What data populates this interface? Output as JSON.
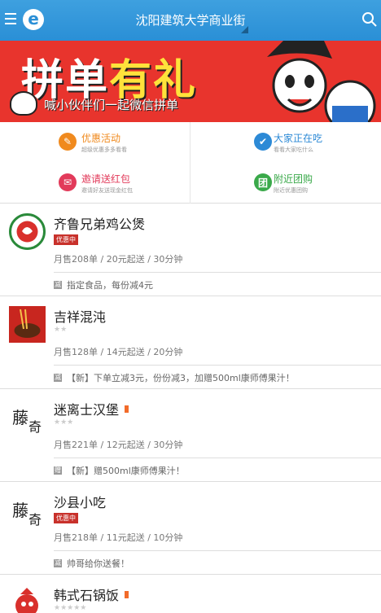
{
  "header": {
    "title": "沈阳建筑大学商业街",
    "logo_letter": "e"
  },
  "banner": {
    "title_a": "拼单",
    "title_b": "有礼",
    "subtitle": "喊小伙伴们一起微信拼单"
  },
  "features": [
    {
      "title": "优惠活动",
      "sub": "超级优惠多多看看",
      "color": "#f08a1e",
      "title_color": "#f08a1e",
      "icon": "tag-icon",
      "glyph": "✎"
    },
    {
      "title": "大家正在吃",
      "sub": "看看大家吃什么",
      "color": "#2d8ad6",
      "title_color": "#2d8ad6",
      "icon": "thumbs-up-icon",
      "glyph": "👍"
    },
    {
      "title": "邀请送红包",
      "sub": "邀请好友送现金红包",
      "color": "#e23a5a",
      "title_color": "#e23a5a",
      "icon": "red-envelope-icon",
      "glyph": "✉"
    },
    {
      "title": "附近团购",
      "sub": "附近优惠团购",
      "color": "#3aa94a",
      "title_color": "#3aa94a",
      "icon": "group-buy-icon",
      "glyph": "团"
    }
  ],
  "restaurants": [
    {
      "name": "齐鲁兄弟鸡公煲",
      "badge": "优惠中",
      "stars": "",
      "meta": "月售208单 / 20元起送 / 30分钟",
      "activity_icon": "减",
      "activity": "指定食品，每份减4元",
      "bookmark": false
    },
    {
      "name": "吉祥混沌",
      "badge": "",
      "stars": "★★",
      "meta": "月售128单 / 14元起送 / 20分钟",
      "activity_icon": "减",
      "activity": "【新】下单立减3元，份份减3，加赠500ml康师傅果汁！",
      "bookmark": false
    },
    {
      "name": "迷离士汉堡",
      "badge": "",
      "stars": "★★★",
      "meta": "月售221单 / 12元起送 / 30分钟",
      "activity_icon": "赠",
      "activity": "【新】赠500ml康师傅果汁！",
      "bookmark": true
    },
    {
      "name": "沙县小吃",
      "badge": "优惠中",
      "stars": "",
      "meta": "月售218单 / 11元起送 / 10分钟",
      "activity_icon": "减",
      "activity": "帅哥给你送餐！",
      "bookmark": false
    },
    {
      "name": "韩式石锅饭",
      "badge": "",
      "stars": "★★★★★",
      "meta": "",
      "activity_icon": "",
      "activity": "",
      "bookmark": true
    }
  ]
}
